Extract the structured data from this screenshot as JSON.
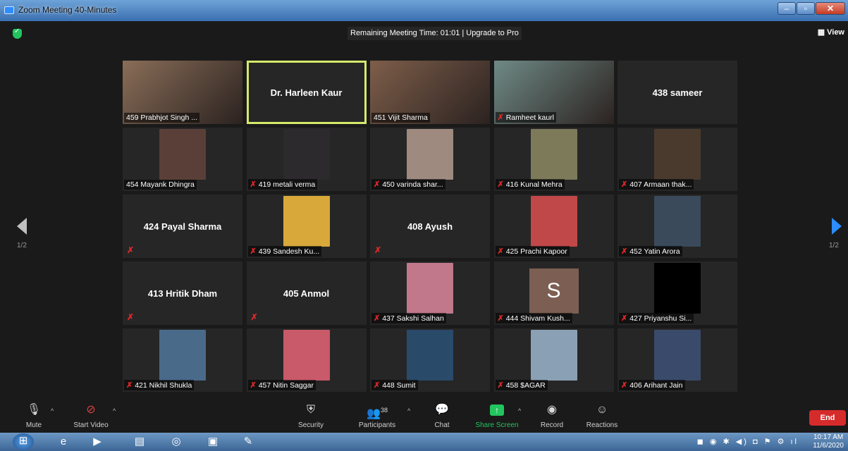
{
  "window": {
    "title": "Zoom Meeting 40-Minutes"
  },
  "meeting": {
    "banner": "Remaining Meeting Time: 01:01 | Upgrade to Pro",
    "view_label": "View"
  },
  "pager": {
    "left": "1/2",
    "right": "1/2"
  },
  "tiles": [
    {
      "name": "459 Prabhjot Singh ...",
      "kind": "video",
      "muted": false,
      "active": false,
      "bg": "#8a6e58"
    },
    {
      "name": "Dr. Harleen Kaur",
      "kind": "name",
      "muted": false,
      "active": true
    },
    {
      "name": "451 Vijit Sharma",
      "kind": "video",
      "muted": false,
      "active": false,
      "bg": "#7e5e4a"
    },
    {
      "name": "Ramheet kaurl",
      "kind": "video",
      "muted": true,
      "active": false,
      "bg": "#6f8a86"
    },
    {
      "name": "438 sameer",
      "kind": "name",
      "muted": false,
      "active": false
    },
    {
      "name": "454 Mayank Dhingra",
      "kind": "photo",
      "muted": false,
      "bg": "#5a3f38"
    },
    {
      "name": "419 metali verma",
      "kind": "photo",
      "muted": true,
      "bg": "#2c2a2c"
    },
    {
      "name": "450 varinda shar...",
      "kind": "photo",
      "muted": true,
      "bg": "#9e8a7e"
    },
    {
      "name": "416 Kunal Mehra",
      "kind": "photo",
      "muted": true,
      "bg": "#7d7a5a"
    },
    {
      "name": "407 Armaan thak...",
      "kind": "photo",
      "muted": true,
      "bg": "#4a3a2e"
    },
    {
      "name": "424 Payal Sharma",
      "kind": "name",
      "muted": true
    },
    {
      "name": "439 Sandesh Ku...",
      "kind": "photo",
      "muted": true,
      "bg": "#d8a83a"
    },
    {
      "name": "408 Ayush",
      "kind": "name",
      "muted": true
    },
    {
      "name": "425 Prachi Kapoor",
      "kind": "photo",
      "muted": true,
      "bg": "#c04848"
    },
    {
      "name": "452 Yatin Arora",
      "kind": "photo",
      "muted": true,
      "bg": "#3a4a5a"
    },
    {
      "name": "413 Hritik Dham",
      "kind": "name",
      "muted": true
    },
    {
      "name": "405 Anmol",
      "kind": "name",
      "muted": true
    },
    {
      "name": "437 Sakshi Salhan",
      "kind": "photo",
      "muted": true,
      "bg": "#c0788a"
    },
    {
      "name": "444 Shivam Kush...",
      "kind": "avatar",
      "muted": true,
      "avatar": "S"
    },
    {
      "name": "427 Priyanshu Si...",
      "kind": "photo",
      "muted": true,
      "bg": "#000000"
    },
    {
      "name": "421 Nikhil Shukla",
      "kind": "photo",
      "muted": true,
      "bg": "#4a6a8a"
    },
    {
      "name": "457 Nitin Saggar",
      "kind": "photo",
      "muted": true,
      "bg": "#c85a6a"
    },
    {
      "name": "448 Sumit",
      "kind": "photo",
      "muted": true,
      "bg": "#2a4a6a"
    },
    {
      "name": "458 $AGAR",
      "kind": "photo",
      "muted": true,
      "bg": "#8aa0b4"
    },
    {
      "name": "406 Arihant Jain",
      "kind": "photo",
      "muted": true,
      "bg": "#3a4a6a"
    }
  ],
  "toolbar": {
    "mute": "Mute",
    "start_video": "Start Video",
    "security": "Security",
    "participants": "Participants",
    "participants_count": "38",
    "chat": "Chat",
    "share_screen": "Share Screen",
    "record": "Record",
    "reactions": "Reactions",
    "end": "End"
  },
  "taskbar": {
    "time": "10:17 AM",
    "date": "11/6/2020"
  }
}
